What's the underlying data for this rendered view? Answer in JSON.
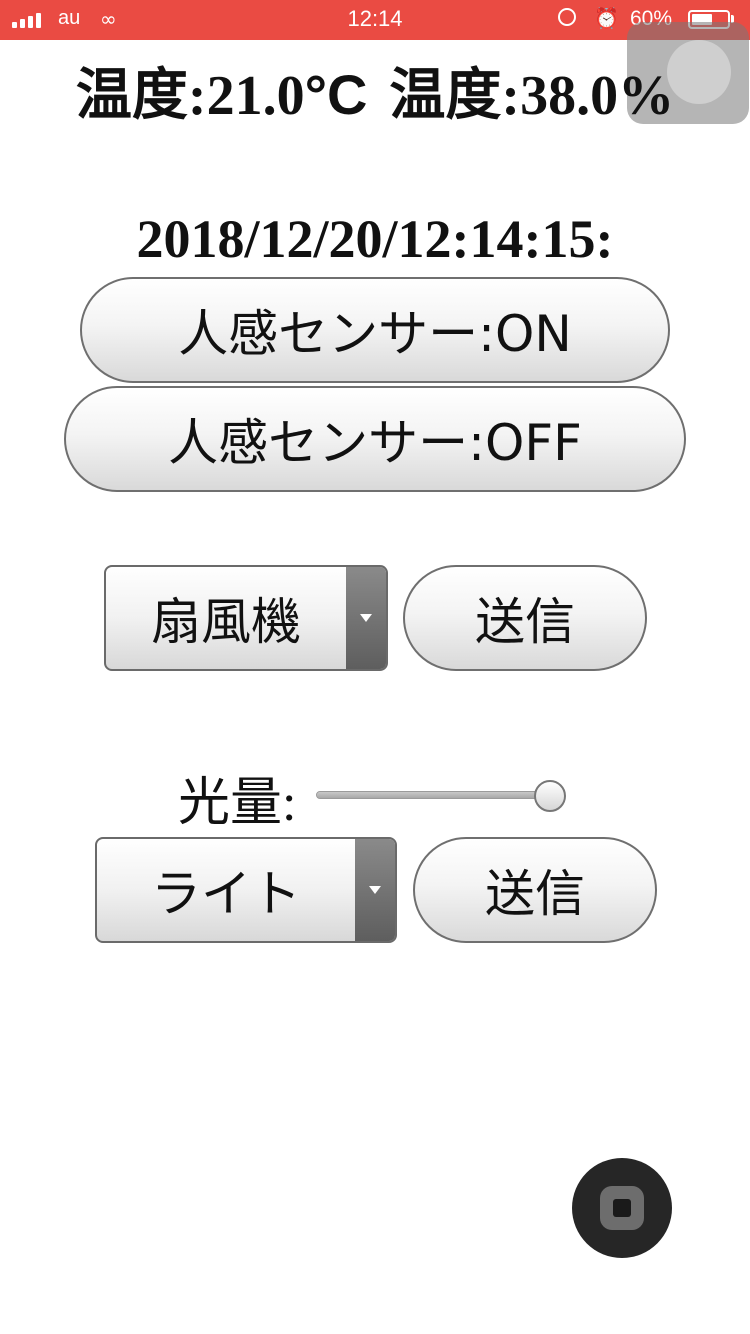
{
  "status_bar": {
    "carrier": "au",
    "time": "12:14",
    "battery_percent": "60%",
    "battery_level": 0.6,
    "color": "#ea4b43"
  },
  "readings": {
    "temperature_label": "温度:",
    "temperature_value": "21.0",
    "temperature_unit": "°C",
    "humidity_label": "温度:",
    "humidity_value": "38.0%"
  },
  "timestamp": "2018/12/20/12:14:15:",
  "sensor_buttons": {
    "on_label": "人感センサー:ON",
    "off_label": "人感センサー:OFF"
  },
  "device_control_1": {
    "selected": "扇風機",
    "send_label": "送信"
  },
  "light_control": {
    "slider_label": "光量:",
    "slider_level": 1.0,
    "selected": "ライト",
    "send_label": "送信"
  },
  "icons": {
    "status": [
      "signal-icon",
      "link-icon",
      "orientation-lock-icon",
      "alarm-icon",
      "battery-icon"
    ],
    "dropdown": "chevron-down-icon",
    "assistive_touch": "assistive-touch-icon"
  }
}
